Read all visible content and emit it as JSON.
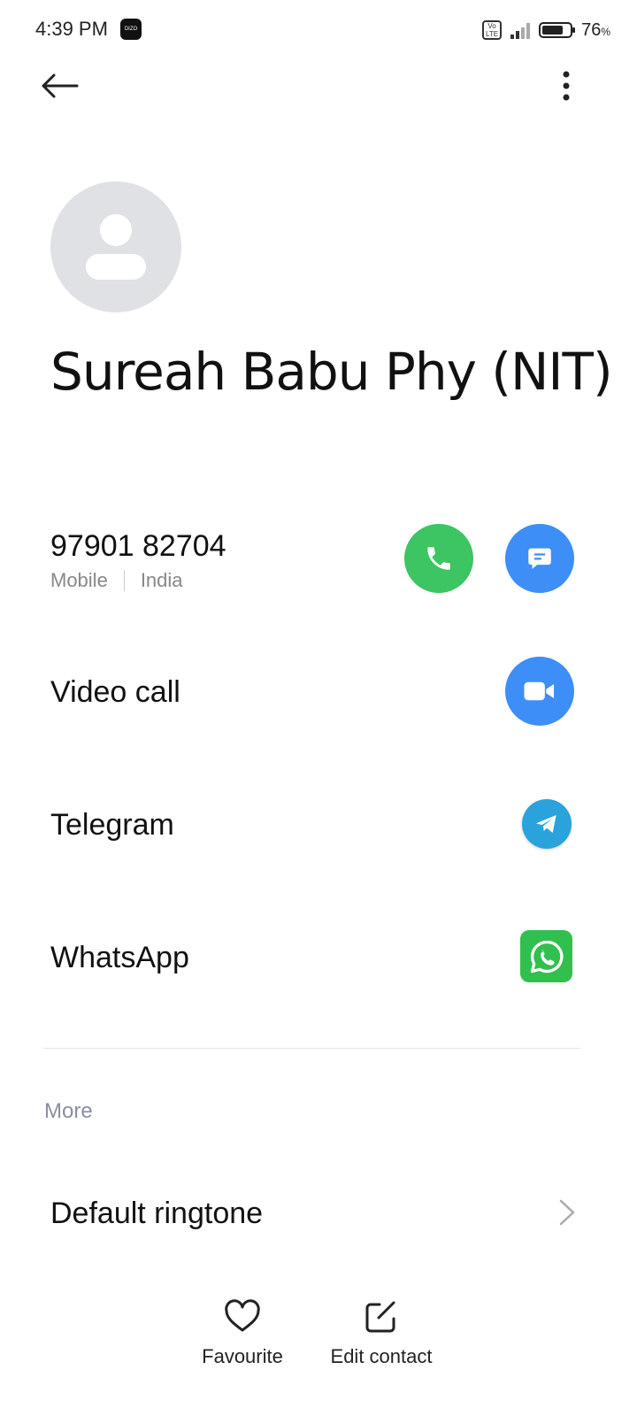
{
  "status_bar": {
    "time": "4:39 PM",
    "app_icon_text": "DIZO",
    "volte_top": "Vo",
    "volte_bottom": "LTE",
    "battery_percent": "76",
    "battery_unit": "%",
    "battery_level": 0.76
  },
  "contact": {
    "name": "Sureah Babu Phy (NIT)",
    "phone_number": "97901 82704",
    "phone_type": "Mobile",
    "phone_region": "India"
  },
  "actions": {
    "video_call": "Video call",
    "telegram": "Telegram",
    "whatsapp": "WhatsApp"
  },
  "more_section": {
    "title": "More",
    "default_ringtone": "Default ringtone"
  },
  "bottom_bar": {
    "favourite": "Favourite",
    "edit_contact": "Edit contact"
  },
  "colors": {
    "call_green": "#3cc562",
    "action_blue": "#3d8ef7",
    "telegram_blue": "#2aa3dd",
    "whatsapp_green": "#31c04f",
    "avatar_gray": "#dfe1e5"
  },
  "icons": {
    "back": "arrow-left-icon",
    "more": "more-vertical-icon",
    "call": "phone-icon",
    "message": "message-icon",
    "video": "video-camera-icon",
    "telegram": "telegram-icon",
    "whatsapp": "whatsapp-icon",
    "ringtone_chevron": "chevron-right-icon",
    "favourite": "heart-icon",
    "edit": "edit-icon"
  }
}
